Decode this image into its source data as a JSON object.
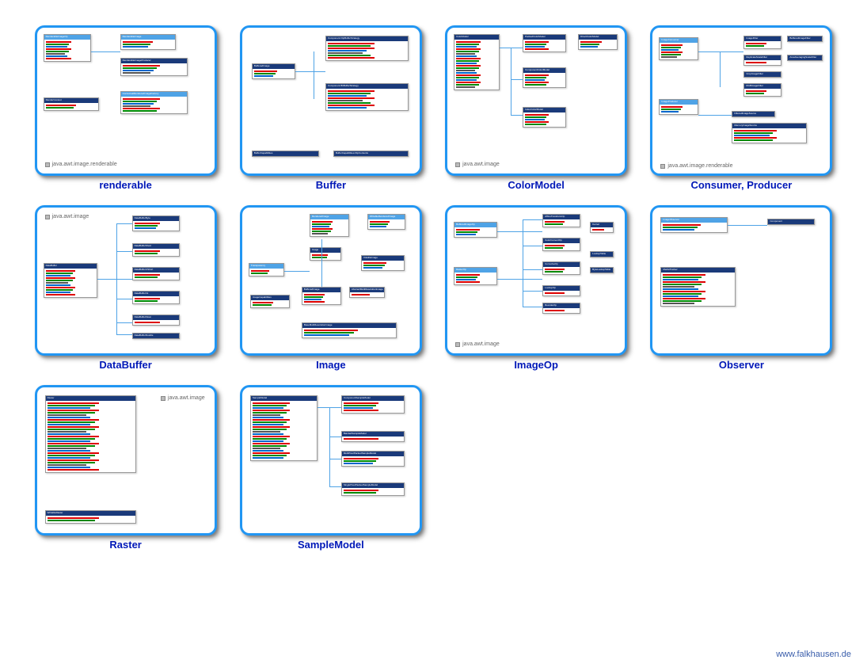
{
  "cards": [
    {
      "label": "renderable",
      "pkg": "java.awt.image.renderable"
    },
    {
      "label": "Buffer",
      "pkg": ""
    },
    {
      "label": "ColorModel",
      "pkg": "java.awt.image"
    },
    {
      "label": "Consumer, Producer",
      "pkg": "java.awt.image.renderable"
    },
    {
      "label": "DataBuffer",
      "pkg": "java.awt.image"
    },
    {
      "label": "Image",
      "pkg": ""
    },
    {
      "label": "ImageOp",
      "pkg": "java.awt.image"
    },
    {
      "label": "Observer",
      "pkg": ""
    },
    {
      "label": "Raster",
      "pkg": "java.awt.image"
    },
    {
      "label": "SampleModel",
      "pkg": ""
    }
  ],
  "footer": "www.falkhausen.de",
  "box_titles": {
    "buffered_image": "BufferedImage",
    "component_flip": "Component.FlipBufferStrategy",
    "component_blt": "Component.BltBufferStrategy",
    "buffer_caps": "BufferCapabilities",
    "databuffer": "DataBuffer",
    "raster": "Raster",
    "samplemodel": "SampleModel",
    "component": "Component",
    "mediatracker": "MediaTracker"
  }
}
